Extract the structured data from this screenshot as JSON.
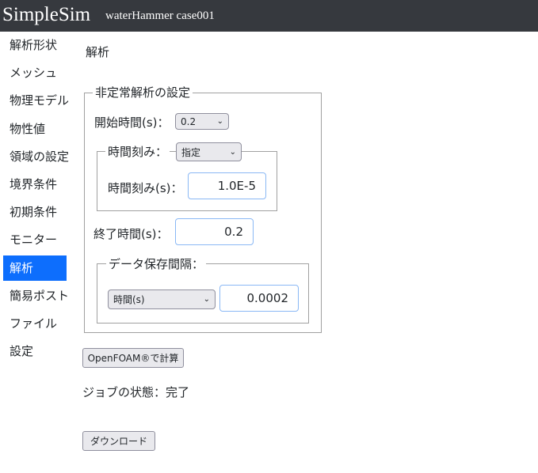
{
  "header": {
    "brand": "SimpleSim",
    "case_name": "waterHammer case001"
  },
  "sidebar": {
    "items": [
      {
        "label": "解析形状"
      },
      {
        "label": "メッシュ"
      },
      {
        "label": "物理モデル"
      },
      {
        "label": "物性値"
      },
      {
        "label": "領域の設定"
      },
      {
        "label": "境界条件"
      },
      {
        "label": "初期条件"
      },
      {
        "label": "モニター"
      },
      {
        "label": "解析",
        "active": true
      },
      {
        "label": "簡易ポスト"
      },
      {
        "label": "ファイル"
      },
      {
        "label": "設定"
      }
    ],
    "active_color": "#0d6efd"
  },
  "main": {
    "title": "解析",
    "transient": {
      "legend": "非定常解析の設定",
      "start_time_label": "開始時間(s)：",
      "start_time_value": "0.2",
      "timestep_legend": "時間刻み：",
      "timestep_mode": "指定",
      "timestep_label": "時間刻み(s)：",
      "timestep_value": "1.0E-5",
      "end_time_label": "終了時間(s)：",
      "end_time_value": "0.2",
      "save_legend": "データ保存間隔：",
      "save_mode": "時間(s)",
      "save_value": "0.0002"
    },
    "run_button": "OpenFOAM®で計算",
    "job_status": "ジョブの状態：完了",
    "download_button": "ダウンロード"
  }
}
